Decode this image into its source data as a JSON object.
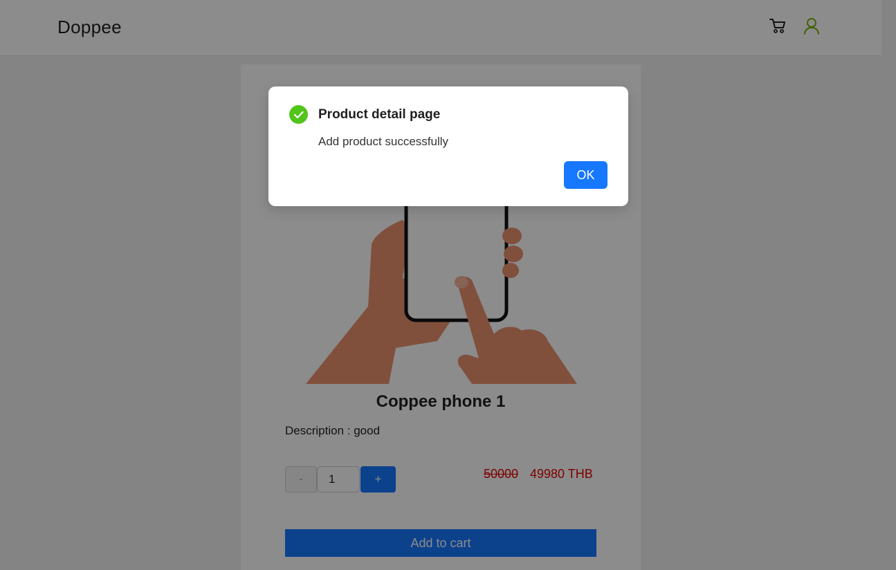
{
  "header": {
    "brand": "Doppee",
    "cart_icon": "cart-icon",
    "user_icon": "user-icon"
  },
  "product": {
    "image_icon": "hand-holding-phone-illustration",
    "title": "Coppee phone 1",
    "description": "Description : good",
    "quantity": "1",
    "minus_label": "-",
    "plus_label": "+",
    "old_price": "50000",
    "new_price": "49980 THB",
    "add_to_cart_label": "Add to cart"
  },
  "modal": {
    "icon": "check-circle-icon",
    "title": "Product detail page",
    "content": "Add product successfully",
    "ok_label": "OK"
  },
  "colors": {
    "primary": "#1677ff",
    "success": "#52c41a",
    "price": "#e60000",
    "user_icon": "#7cb305"
  }
}
